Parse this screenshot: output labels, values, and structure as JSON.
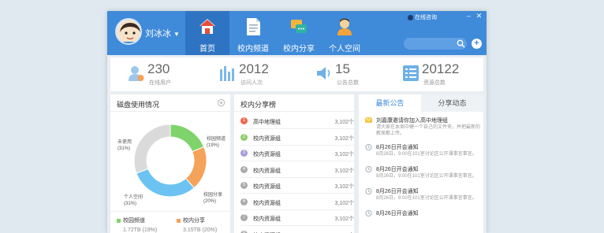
{
  "user": {
    "name": "刘冰冰"
  },
  "window": {
    "online_label": "在线咨询",
    "min_icon": "minimize-icon",
    "close_icon": "close-icon"
  },
  "nav": [
    {
      "label": "首页",
      "icon": "home-icon",
      "active": true
    },
    {
      "label": "校内频道",
      "icon": "document-icon",
      "active": false
    },
    {
      "label": "校内分享",
      "icon": "share-chat-icon",
      "active": false
    },
    {
      "label": "个人空间",
      "icon": "person-icon",
      "active": false
    }
  ],
  "search": {
    "placeholder": ""
  },
  "stats": [
    {
      "value": "230",
      "label": "在线用户",
      "icon": "user-icon"
    },
    {
      "value": "2012",
      "label": "访问人次",
      "icon": "bar-chart-icon"
    },
    {
      "value": "15",
      "label": "公告总数",
      "icon": "speaker-icon"
    },
    {
      "value": "20122",
      "label": "资源总数",
      "icon": "list-icon"
    }
  ],
  "disk": {
    "title": "磁盘使用情况",
    "labels": {
      "unused": [
        "未使用",
        "(31%)"
      ],
      "channel": [
        "校园频道",
        "(19%)"
      ],
      "share": [
        "校园分享",
        "(20%)"
      ],
      "personal": [
        "个人空间",
        "(31%)"
      ]
    },
    "legend": [
      {
        "name": "校园频道",
        "value": "1.72TB (19%)"
      },
      {
        "name": "校内分享",
        "value": "3.15TB (20%)"
      }
    ]
  },
  "chart_data": {
    "type": "pie",
    "title": "磁盘使用情况",
    "labels": [
      "校园频道",
      "校园分享",
      "个人空间",
      "未使用"
    ],
    "values": [
      19,
      20,
      31,
      31
    ],
    "colors": [
      "#7ed46a",
      "#f5a25a",
      "#6cc3f2",
      "#dadada"
    ]
  },
  "ranking": {
    "title": "校内分享榜",
    "items": [
      {
        "rank": "1",
        "name": "高中地理组",
        "count": "3,102个"
      },
      {
        "rank": "2",
        "name": "校内资源组",
        "count": "3,102个"
      },
      {
        "rank": "3",
        "name": "校内资源组",
        "count": "3,102个"
      },
      {
        "rank": "4",
        "name": "校内资源组",
        "count": "3,102个"
      },
      {
        "rank": "5",
        "name": "校内资源组",
        "count": "3,102个"
      },
      {
        "rank": "6",
        "name": "校内资源组",
        "count": "3,102个"
      },
      {
        "rank": "7",
        "name": "校内资源组",
        "count": "3,102个"
      },
      {
        "rank": "8",
        "name": "校内资源组",
        "count": "3,102个"
      }
    ],
    "rank_colors": [
      "#f0694f",
      "#8dcf6a",
      "#a99bd9",
      "#aaaaaa"
    ]
  },
  "notices": {
    "tabs": [
      "最新公告",
      "分享动态"
    ],
    "items": [
      {
        "title": "刘嘉康邀请你加入高中地理组",
        "body": "请大家在本周中健一个自己的文件夹，并把最新的教案都上传。",
        "icon": "envelope-icon"
      },
      {
        "title": "8月26日开会通知",
        "body": "8月26日，9:00在101室讨论区公开课事宜事宜。",
        "icon": "clock-icon"
      },
      {
        "title": "8月26日开会通知",
        "body": "8月26日，9:00在101室讨论区公开课事宜事宜。",
        "icon": "clock-icon"
      },
      {
        "title": "8月26日开会通知",
        "body": "8月26日，9:00在101室讨论区公开课事宜事宜。",
        "icon": "clock-icon"
      },
      {
        "title": "8月26日开会通知",
        "body": "",
        "icon": "clock-icon"
      }
    ]
  },
  "colors": {
    "brand": "#3f8ad9",
    "brand_dark": "#2e74c2"
  }
}
